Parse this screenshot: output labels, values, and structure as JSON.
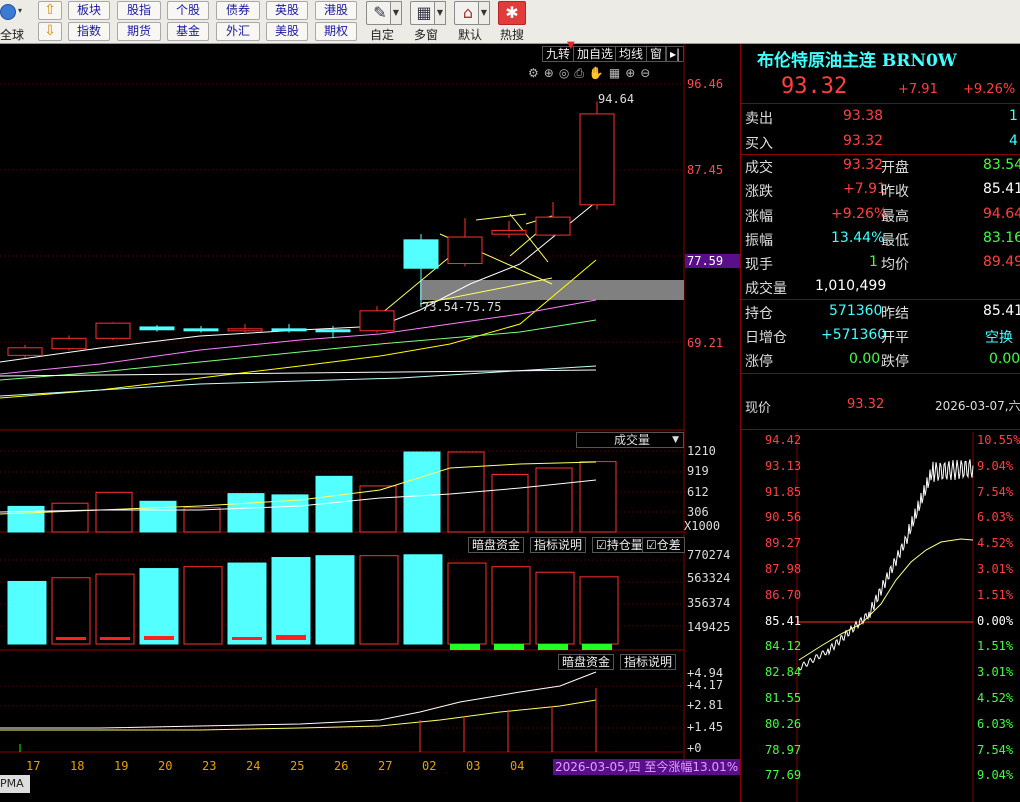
{
  "toolbar": {
    "left_label": "全球",
    "top_row": [
      "板块",
      "股指",
      "个股",
      "债券",
      "英股",
      "港股"
    ],
    "bottom_row": [
      "指数",
      "期货",
      "基金",
      "外汇",
      "美股",
      "期权"
    ],
    "big_buttons": [
      "自定",
      "多窗",
      "默认",
      "热搜"
    ]
  },
  "chart": {
    "top_buttons": [
      "九转",
      "加自选",
      "均线",
      "窗"
    ],
    "price_ticks": [
      "96.46",
      "87.45",
      "77.59",
      "69.21"
    ],
    "current_price_tag": "77.59",
    "hi_label": "94.64",
    "zone_label": "73.54-75.75",
    "vol_title": "成交量",
    "vol_ticks": [
      "1210",
      "919",
      "612",
      "306",
      "X1000"
    ],
    "oi_buttons": [
      "暗盘资金",
      "指标说明",
      "持仓量",
      "仓差"
    ],
    "oi_ticks": [
      "770274",
      "563324",
      "356374",
      "149425"
    ],
    "ind_buttons": [
      "暗盘资金",
      "指标说明"
    ],
    "ind_ticks": [
      "+4.94",
      "+4.17",
      "+2.81",
      "+1.45",
      "+0"
    ],
    "x_dates": [
      "17",
      "18",
      "19",
      "20",
      "23",
      "24",
      "25",
      "26",
      "27",
      "02",
      "03",
      "04"
    ],
    "status": "2026-03-05,四 至今涨幅13.01%",
    "bottom_left": "PMA",
    "colors": {
      "up": "#ff3030",
      "down": "#54ffff",
      "ma1": "#ffffff",
      "ma2": "#ffff00",
      "ma3": "#ff80ff",
      "ma4": "#00ff00"
    }
  },
  "quote": {
    "title": "布伦特原油主连 BRN0W",
    "price": "93.32",
    "change": "+7.91",
    "pct": "+9.26%",
    "sell": {
      "label": "卖出",
      "price": "93.38",
      "qty": "1"
    },
    "buy": {
      "label": "买入",
      "price": "93.32",
      "qty": "4"
    },
    "stats_left": [
      {
        "label": "成交",
        "value": "93.32"
      },
      {
        "label": "涨跌",
        "value": "+7.91"
      },
      {
        "label": "涨幅",
        "value": "+9.26%"
      },
      {
        "label": "振幅",
        "value": "13.44%"
      },
      {
        "label": "现手",
        "value": "1"
      },
      {
        "label": "成交量",
        "value": "1,010,499"
      }
    ],
    "stats_right": [
      {
        "label": "开盘",
        "value": "83.54"
      },
      {
        "label": "昨收",
        "value": "85.41"
      },
      {
        "label": "最高",
        "value": "94.64"
      },
      {
        "label": "最低",
        "value": "83.16"
      },
      {
        "label": "均价",
        "value": "89.49"
      }
    ],
    "oi_rows": [
      {
        "label": "持仓",
        "value": "571360",
        "label2": "昨结",
        "value2": "85.41"
      },
      {
        "label": "日增仓",
        "value": "+571360",
        "label2": "开平",
        "value2": "空换"
      },
      {
        "label": "涨停",
        "value": "0.00",
        "label2": "跌停",
        "value2": "0.00"
      }
    ],
    "now_label": "现价",
    "now_value": "93.32",
    "now_date": "2026-03-07,六"
  },
  "intraday": {
    "left_ticks": [
      "94.42",
      "93.13",
      "91.85",
      "90.56",
      "89.27",
      "87.98",
      "86.70",
      "85.41",
      "84.12",
      "82.84",
      "81.55",
      "80.26",
      "78.97",
      "77.69"
    ],
    "right_ticks": [
      "10.55%",
      "9.04%",
      "7.54%",
      "6.03%",
      "4.52%",
      "3.01%",
      "1.51%",
      "0.00%",
      "1.51%",
      "3.01%",
      "4.52%",
      "6.03%",
      "7.54%",
      "9.04%"
    ]
  }
}
